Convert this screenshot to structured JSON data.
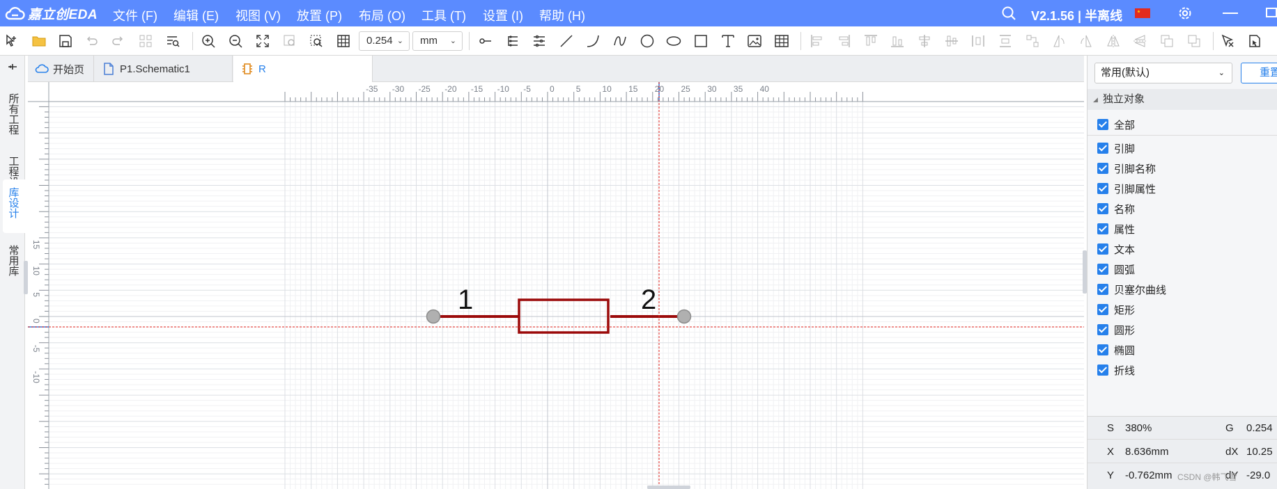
{
  "app": {
    "logo_text": "嘉立创EDA",
    "version_label": "V2.1.56 | 半离线"
  },
  "menu": [
    {
      "label": "文件 (F)"
    },
    {
      "label": "编辑 (E)"
    },
    {
      "label": "视图 (V)"
    },
    {
      "label": "放置 (P)"
    },
    {
      "label": "布局 (O)"
    },
    {
      "label": "工具 (T)"
    },
    {
      "label": "设置 (I)"
    },
    {
      "label": "帮助 (H)"
    }
  ],
  "toolbar": {
    "grid_size": "0.254",
    "unit": "mm"
  },
  "left_tabs": [
    {
      "label": "所有工程"
    },
    {
      "label": "工程设计"
    },
    {
      "label": "库设计",
      "active": true
    },
    {
      "label": "常用库"
    }
  ],
  "doc_tabs": [
    {
      "label": "开始页"
    },
    {
      "label": "P1.Schematic1"
    },
    {
      "label": "R",
      "active": true
    }
  ],
  "ruler": {
    "top_labels": [
      "-35",
      "-30",
      "-25",
      "-20",
      "-15",
      "-10",
      "-5",
      "0",
      "5",
      "10",
      "15",
      "20",
      "25",
      "30",
      "35",
      "40"
    ],
    "left_labels": [
      "15",
      "10",
      "5",
      "0",
      "-5",
      "-10"
    ]
  },
  "symbol": {
    "pin1_number": "1",
    "pin2_number": "2"
  },
  "colors": {
    "menubar": "#5b8bff",
    "accent": "#2680eb",
    "symbol_stroke": "#9b0a0a",
    "crosshair": "#e0211b",
    "pin_end": "#9a9a9a"
  },
  "right_panel": {
    "filter_select": "常用(默认)",
    "reset_label": "重置",
    "section_title": "独立对象",
    "checkbox_all": "全部",
    "checkboxes": [
      "引脚",
      "引脚名称",
      "引脚属性",
      "名称",
      "属性",
      "文本",
      "圆弧",
      "贝塞尔曲线",
      "矩形",
      "圆形",
      "椭圆",
      "折线"
    ]
  },
  "status": {
    "scale_label": "S",
    "scale_value": "380%",
    "grid_label": "G",
    "grid_value": "0.254",
    "x_label": "X",
    "x_value": "8.636mm",
    "dx_label": "dX",
    "dx_value": "10.25",
    "y_label": "Y",
    "y_value": "-0.762mm",
    "dy_label": "dY",
    "dy_value": "-29.0"
  },
  "watermark": "CSDN @韩飞雪"
}
